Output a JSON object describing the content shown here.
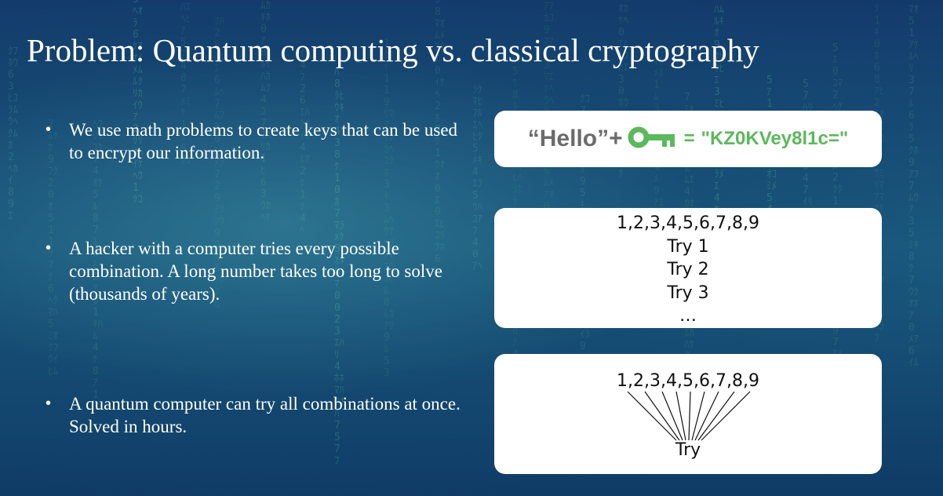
{
  "slide": {
    "title": "Problem: Quantum computing vs. classical cryptography"
  },
  "bullets": [
    {
      "text": "We use math problems to create keys that can be used to encrypt our information."
    },
    {
      "text": "A hacker with a computer tries every possible combination. A long number takes too long to solve (thousands of years)."
    },
    {
      "text": "A quantum computer can try all combinations at once. Solved in hours."
    }
  ],
  "bullet_marker": "•",
  "encrypt_card": {
    "plaintext": "“Hello”",
    "plus": "+",
    "key_icon": "key-icon",
    "equals": "=",
    "ciphertext": "\"KZ0KVey8l1c=\""
  },
  "classic_card": {
    "lines": [
      "1,2,3,4,5,6,7,8,9",
      "Try 1",
      "Try 2",
      "Try 3",
      "…"
    ]
  },
  "quantum_card": {
    "sequence": "1,2,3,4,5,6,7,8,9",
    "result": "Try"
  },
  "colors": {
    "key_green": "#5cb85c",
    "hello_gray": "#6b6b6b",
    "background_deep": "#133a6b",
    "background_teal": "#1a5a7e"
  }
}
